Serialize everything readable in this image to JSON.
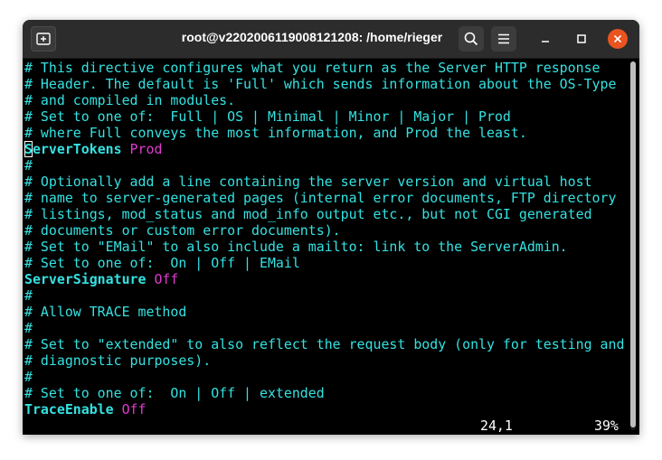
{
  "window": {
    "title": "root@v2202006119008121208: /home/rieger"
  },
  "titlebar_icons": {
    "new_tab": "new-tab-icon",
    "search": "search-icon",
    "menu": "hamburger-menu-icon",
    "minimize": "minimize-icon",
    "maximize": "maximize-icon",
    "close": "close-icon"
  },
  "colors": {
    "comment": "#34e2e2",
    "directive": "#34e2e2",
    "value": "#e23bd0",
    "close_button": "#e95420",
    "titlebar": "#2c2c2c",
    "terminal_bg": "#000000"
  },
  "lines": [
    {
      "type": "comment",
      "text": "# This directive configures what you return as the Server HTTP response"
    },
    {
      "type": "comment",
      "text": "# Header. The default is 'Full' which sends information about the OS-Type"
    },
    {
      "type": "comment",
      "text": "# and compiled in modules."
    },
    {
      "type": "comment",
      "text": "# Set to one of:  Full | OS | Minimal | Minor | Major | Prod"
    },
    {
      "type": "comment",
      "text": "# where Full conveys the most information, and Prod the least."
    },
    {
      "type": "directive",
      "cursor_char": "S",
      "directive": "erverTokens",
      "value": " Prod"
    },
    {
      "type": "comment",
      "text": "#"
    },
    {
      "type": "comment",
      "text": "# Optionally add a line containing the server version and virtual host"
    },
    {
      "type": "comment",
      "text": "# name to server-generated pages (internal error documents, FTP directory"
    },
    {
      "type": "comment",
      "text": "# listings, mod_status and mod_info output etc., but not CGI generated"
    },
    {
      "type": "comment",
      "text": "# documents or custom error documents)."
    },
    {
      "type": "comment",
      "text": "# Set to \"EMail\" to also include a mailto: link to the ServerAdmin."
    },
    {
      "type": "comment",
      "text": "# Set to one of:  On | Off | EMail"
    },
    {
      "type": "directive",
      "directive": "ServerSignature",
      "value": " Off"
    },
    {
      "type": "comment",
      "text": "#"
    },
    {
      "type": "comment",
      "text": "# Allow TRACE method"
    },
    {
      "type": "comment",
      "text": "#"
    },
    {
      "type": "comment",
      "text": "# Set to \"extended\" to also reflect the request body (only for testing and"
    },
    {
      "type": "comment",
      "text": "# diagnostic purposes)."
    },
    {
      "type": "comment",
      "text": "#"
    },
    {
      "type": "comment",
      "text": "# Set to one of:  On | Off | extended"
    },
    {
      "type": "directive",
      "directive": "TraceEnable",
      "value": " Off"
    }
  ],
  "status": {
    "position": "24,1",
    "percent": "39%"
  }
}
